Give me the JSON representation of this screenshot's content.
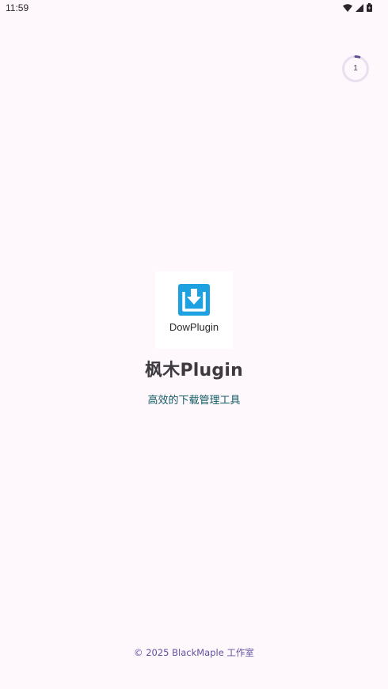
{
  "status_bar": {
    "time": "11:59",
    "icons": [
      "wifi-icon",
      "cellular-signal-icon",
      "battery-icon"
    ]
  },
  "countdown": {
    "value": "1",
    "progress": 0.05,
    "track_color": "#e6e0ef",
    "progress_color": "#5b4f91"
  },
  "splash": {
    "logo_text": "DowPlugin",
    "logo_color": "#1ea1e1",
    "app_name": "枫木Plugin",
    "tagline": "高效的下载管理工具"
  },
  "footer": {
    "copyright": "© 2025 BlackMaple 工作室"
  },
  "colors": {
    "background": "#fef7fc",
    "tagline": "#0f5a62",
    "footer": "#5f52a0"
  }
}
